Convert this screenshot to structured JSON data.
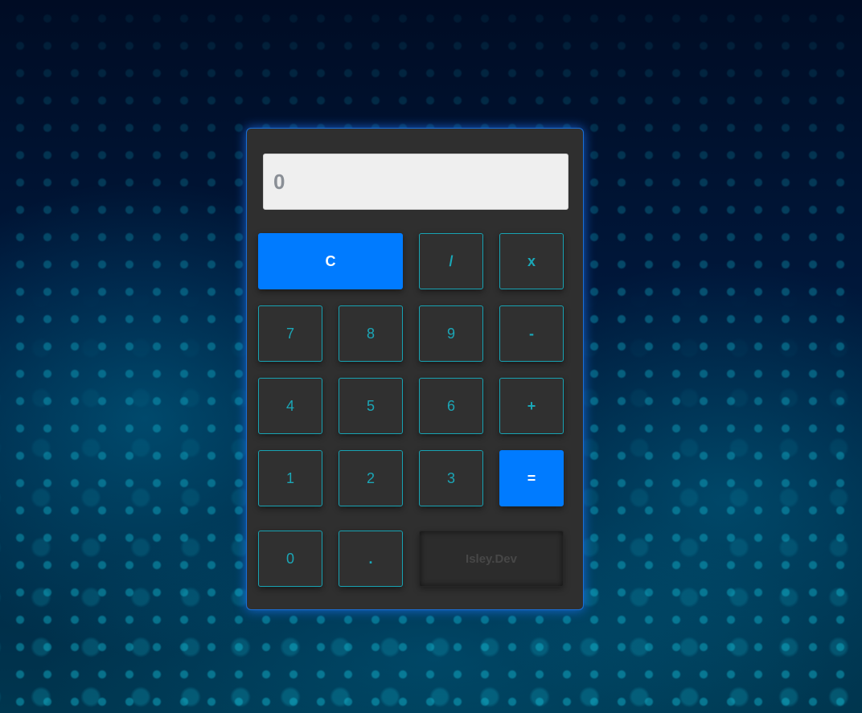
{
  "display": {
    "value": "0"
  },
  "buttons": {
    "clear": "C",
    "divide": "/",
    "multiply": "x",
    "seven": "7",
    "eight": "8",
    "nine": "9",
    "subtract": "-",
    "four": "4",
    "five": "5",
    "six": "6",
    "add": "+",
    "one": "1",
    "two": "2",
    "three": "3",
    "equals": "=",
    "zero": "0",
    "decimal": "."
  },
  "signature": "Isley.Dev",
  "colors": {
    "accent": "#007bff",
    "button_text": "#1aa8b8",
    "button_border": "#18a3b3",
    "panel": "#2f2f2f",
    "display_bg": "#efefef",
    "display_text": "#8a8f96",
    "glow": "#1e78ff"
  }
}
